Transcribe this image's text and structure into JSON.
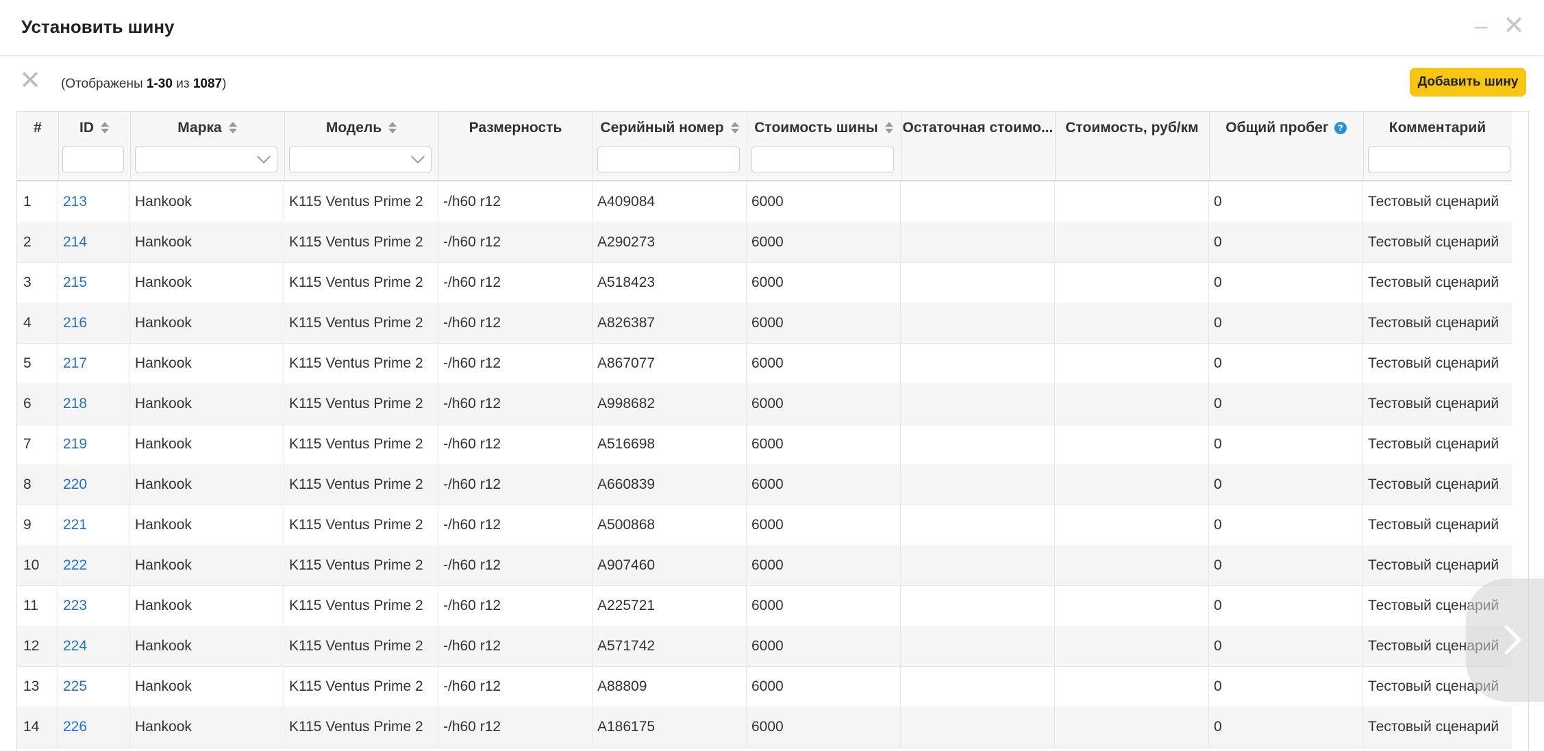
{
  "dialog": {
    "title": "Установить шину",
    "minimize_icon": "minimize-icon",
    "close_icon": "close-icon"
  },
  "toolbar": {
    "counter_prefix": "(Отображены ",
    "counter_range": "1-30",
    "counter_mid": " из ",
    "counter_total": "1087",
    "counter_suffix": ")",
    "add_button": "Добавить шину"
  },
  "columns": [
    {
      "key": "num",
      "label": "#"
    },
    {
      "key": "id",
      "label": "ID"
    },
    {
      "key": "brand",
      "label": "Марка"
    },
    {
      "key": "model",
      "label": "Модель"
    },
    {
      "key": "size",
      "label": "Размерность"
    },
    {
      "key": "serial",
      "label": "Серийный номер"
    },
    {
      "key": "cost",
      "label": "Стоимость шины"
    },
    {
      "key": "residual",
      "label": "Остаточная стоимо..."
    },
    {
      "key": "cost_per_km",
      "label": "Стоимость, руб/км"
    },
    {
      "key": "mileage",
      "label": "Общий пробег"
    },
    {
      "key": "comment",
      "label": "Комментарий"
    }
  ],
  "rows": [
    {
      "num": "1",
      "id": "213",
      "brand": "Hankook",
      "model": "K115 Ventus Prime 2",
      "size": "-/h60 r12",
      "serial": "A409084",
      "cost": "6000",
      "residual": "",
      "cost_per_km": "",
      "mileage": "0",
      "comment": "Тестовый сценарий"
    },
    {
      "num": "2",
      "id": "214",
      "brand": "Hankook",
      "model": "K115 Ventus Prime 2",
      "size": "-/h60 r12",
      "serial": "A290273",
      "cost": "6000",
      "residual": "",
      "cost_per_km": "",
      "mileage": "0",
      "comment": "Тестовый сценарий"
    },
    {
      "num": "3",
      "id": "215",
      "brand": "Hankook",
      "model": "K115 Ventus Prime 2",
      "size": "-/h60 r12",
      "serial": "A518423",
      "cost": "6000",
      "residual": "",
      "cost_per_km": "",
      "mileage": "0",
      "comment": "Тестовый сценарий"
    },
    {
      "num": "4",
      "id": "216",
      "brand": "Hankook",
      "model": "K115 Ventus Prime 2",
      "size": "-/h60 r12",
      "serial": "A826387",
      "cost": "6000",
      "residual": "",
      "cost_per_km": "",
      "mileage": "0",
      "comment": "Тестовый сценарий"
    },
    {
      "num": "5",
      "id": "217",
      "brand": "Hankook",
      "model": "K115 Ventus Prime 2",
      "size": "-/h60 r12",
      "serial": "A867077",
      "cost": "6000",
      "residual": "",
      "cost_per_km": "",
      "mileage": "0",
      "comment": "Тестовый сценарий"
    },
    {
      "num": "6",
      "id": "218",
      "brand": "Hankook",
      "model": "K115 Ventus Prime 2",
      "size": "-/h60 r12",
      "serial": "A998682",
      "cost": "6000",
      "residual": "",
      "cost_per_km": "",
      "mileage": "0",
      "comment": "Тестовый сценарий"
    },
    {
      "num": "7",
      "id": "219",
      "brand": "Hankook",
      "model": "K115 Ventus Prime 2",
      "size": "-/h60 r12",
      "serial": "A516698",
      "cost": "6000",
      "residual": "",
      "cost_per_km": "",
      "mileage": "0",
      "comment": "Тестовый сценарий"
    },
    {
      "num": "8",
      "id": "220",
      "brand": "Hankook",
      "model": "K115 Ventus Prime 2",
      "size": "-/h60 r12",
      "serial": "A660839",
      "cost": "6000",
      "residual": "",
      "cost_per_km": "",
      "mileage": "0",
      "comment": "Тестовый сценарий"
    },
    {
      "num": "9",
      "id": "221",
      "brand": "Hankook",
      "model": "K115 Ventus Prime 2",
      "size": "-/h60 r12",
      "serial": "A500868",
      "cost": "6000",
      "residual": "",
      "cost_per_km": "",
      "mileage": "0",
      "comment": "Тестовый сценарий"
    },
    {
      "num": "10",
      "id": "222",
      "brand": "Hankook",
      "model": "K115 Ventus Prime 2",
      "size": "-/h60 r12",
      "serial": "A907460",
      "cost": "6000",
      "residual": "",
      "cost_per_km": "",
      "mileage": "0",
      "comment": "Тестовый сценарий"
    },
    {
      "num": "11",
      "id": "223",
      "brand": "Hankook",
      "model": "K115 Ventus Prime 2",
      "size": "-/h60 r12",
      "serial": "A225721",
      "cost": "6000",
      "residual": "",
      "cost_per_km": "",
      "mileage": "0",
      "comment": "Тестовый сценарий"
    },
    {
      "num": "12",
      "id": "224",
      "brand": "Hankook",
      "model": "K115 Ventus Prime 2",
      "size": "-/h60 r12",
      "serial": "A571742",
      "cost": "6000",
      "residual": "",
      "cost_per_km": "",
      "mileage": "0",
      "comment": "Тестовый сценарий"
    },
    {
      "num": "13",
      "id": "225",
      "brand": "Hankook",
      "model": "K115 Ventus Prime 2",
      "size": "-/h60 r12",
      "serial": "A88809",
      "cost": "6000",
      "residual": "",
      "cost_per_km": "",
      "mileage": "0",
      "comment": "Тестовый сценарий"
    },
    {
      "num": "14",
      "id": "226",
      "brand": "Hankook",
      "model": "K115 Ventus Prime 2",
      "size": "-/h60 r12",
      "serial": "A186175",
      "cost": "6000",
      "residual": "",
      "cost_per_km": "",
      "mileage": "0",
      "comment": "Тестовый сценарий"
    }
  ],
  "colors": {
    "accent": "#f7c614",
    "link": "#2572c4",
    "help": "#2a8fd8"
  },
  "icons": {
    "help": "question-circle-icon",
    "next": "chevron-right-icon",
    "sort": "sort-icon"
  }
}
